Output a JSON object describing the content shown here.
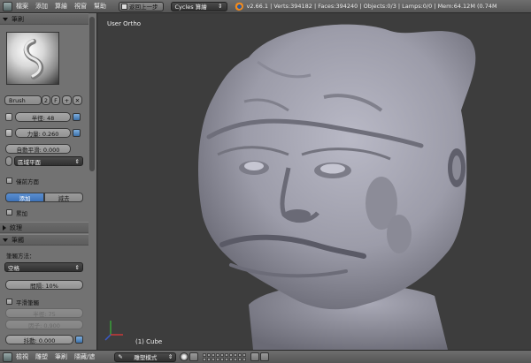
{
  "topbar": {
    "menus": [
      "檔案",
      "添加",
      "算繪",
      "視窗",
      "幫助"
    ],
    "undo_label": "返回上一步",
    "render_engine": "Cycles 算繪",
    "stats": "v2.66.1 | Verts:394182 | Faces:394240 | Objects:0/3 | Lamps:0/0 | Mem:64.12M (0.74M"
  },
  "toolshelf": {
    "brush_panel_title": "筆刷",
    "brush_name": "Brush",
    "brush_users": "2",
    "brush_fake_user": "F",
    "radius": "半徑: 48",
    "strength": "力量: 0.260",
    "autosmooth": "自動平滑: 0.000",
    "sculpt_plane": "區域平面",
    "front_faces_only": "僅前方面",
    "add_label": "添加",
    "subtract_label": "減去",
    "accumulate_label": "累加",
    "texture_panel_title": "紋理",
    "stroke_panel_title": "筆觸",
    "stroke_method_label": "筆觸方法：",
    "stroke_method_value": "空格",
    "spacing": "間隔: 10%",
    "smooth_stroke_label": "平滑筆觸",
    "smooth_radius": "半徑: 75",
    "smooth_factor": "因子: 0.900",
    "jitter": "抖動: 0.000"
  },
  "viewport": {
    "view_label": "User Ortho",
    "object_label": "(1) Cube"
  },
  "bottombar": {
    "menus": [
      "檢視",
      "雕塑",
      "筆刷",
      "隱藏/遮"
    ],
    "mode": "雕塑模式"
  }
}
